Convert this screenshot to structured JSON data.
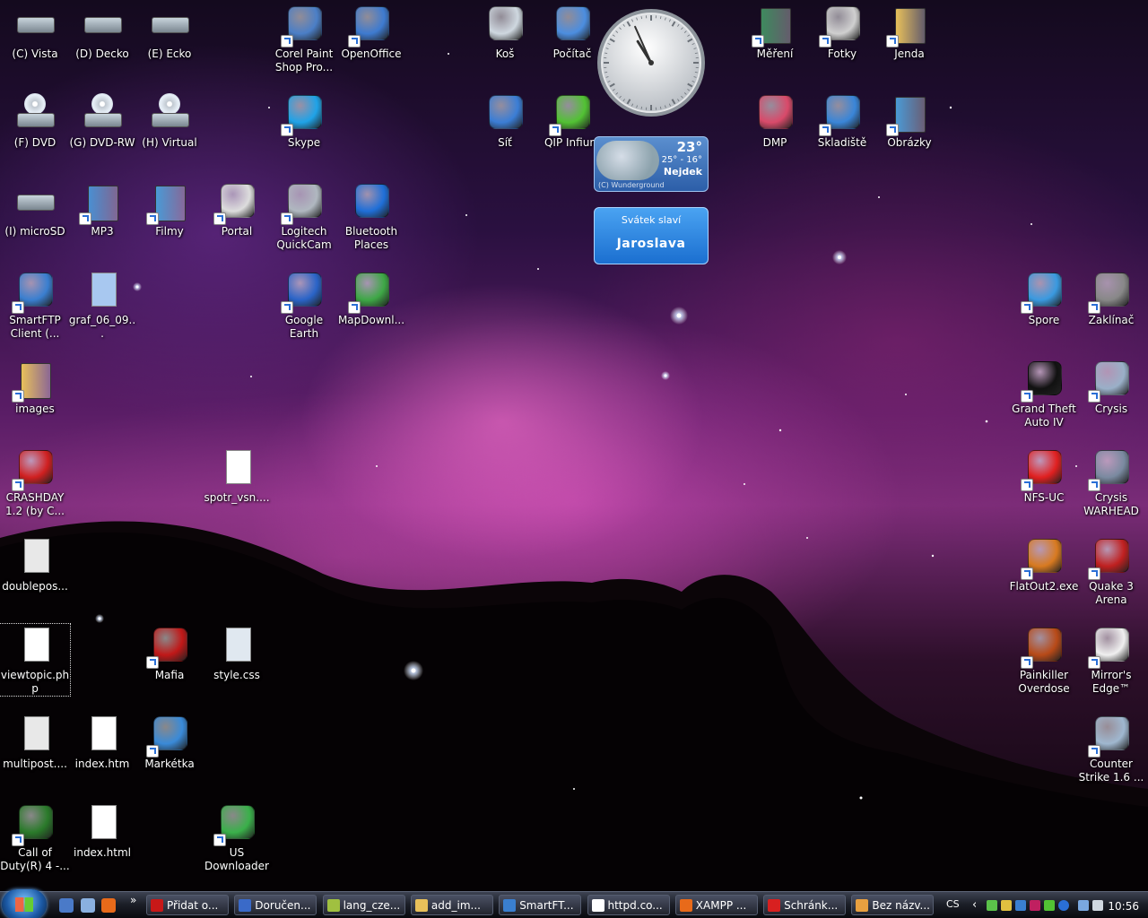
{
  "desktop_icons": [
    {
      "id": "drive-c",
      "label": "(C) Vista",
      "icon": "hard-drive-icon",
      "color": "#c8d4dc"
    },
    {
      "id": "drive-d",
      "label": "(D) Decko",
      "icon": "hard-drive-icon",
      "color": "#c8d4dc"
    },
    {
      "id": "drive-e",
      "label": "(E) Ecko",
      "icon": "hard-drive-icon",
      "color": "#c8d4dc"
    },
    {
      "id": "corel",
      "label": "Corel Paint Shop Pro...",
      "icon": "camera-lens-icon",
      "color": "#4b7fc7"
    },
    {
      "id": "openoffice",
      "label": "OpenOffice",
      "icon": "openoffice-icon",
      "color": "#3e7bd0"
    },
    {
      "id": "kos",
      "label": "Koš",
      "icon": "recycle-bin-icon",
      "color": "#cfd8e0"
    },
    {
      "id": "pocitac",
      "label": "Počítač",
      "icon": "computer-icon",
      "color": "#4c8ee0"
    },
    {
      "id": "mereni",
      "label": "Měření",
      "icon": "folder-icon",
      "color": "#3e8a5e"
    },
    {
      "id": "fotky",
      "label": "Fotky",
      "icon": "camera-icon",
      "color": "#d0d0d0"
    },
    {
      "id": "jenda",
      "label": "Jenda",
      "icon": "folder-icon",
      "color": "#e8c05a"
    },
    {
      "id": "drive-f",
      "label": "(F) DVD",
      "icon": "dvd-drive-icon",
      "color": "#c8d4dc"
    },
    {
      "id": "drive-g",
      "label": "(G) DVD-RW",
      "icon": "dvd-drive-icon",
      "color": "#c8d4dc"
    },
    {
      "id": "drive-h",
      "label": "(H) Virtual",
      "icon": "hd-dvd-drive-icon",
      "color": "#c8d4dc"
    },
    {
      "id": "skype",
      "label": "Skype",
      "icon": "skype-icon",
      "color": "#1fa3e8"
    },
    {
      "id": "sit",
      "label": "Síť",
      "icon": "network-icon",
      "color": "#3b7ed6"
    },
    {
      "id": "qip",
      "label": "QIP Infium",
      "icon": "qip-icon",
      "color": "#52c234"
    },
    {
      "id": "dmp",
      "label": "DMP",
      "icon": "dmp-icon",
      "color": "#d94a6a"
    },
    {
      "id": "skladiste",
      "label": "Skladiště",
      "icon": "monitor-icon",
      "color": "#3a86d8"
    },
    {
      "id": "obrazky",
      "label": "Obrázky",
      "icon": "folder-icon",
      "color": "#4a9ad6"
    },
    {
      "id": "drive-i",
      "label": "(I) microSD",
      "icon": "hard-drive-icon",
      "color": "#c8d4dc"
    },
    {
      "id": "mp3",
      "label": "MP3",
      "icon": "music-folder-icon",
      "color": "#4a8fd2"
    },
    {
      "id": "filmy",
      "label": "Filmy",
      "icon": "video-folder-icon",
      "color": "#4a9ad6"
    },
    {
      "id": "portal",
      "label": "Portal",
      "icon": "portal-icon",
      "color": "#dddddd"
    },
    {
      "id": "quickcam",
      "label": "Logitech QuickCam",
      "icon": "webcam-icon",
      "color": "#b0b8c0"
    },
    {
      "id": "bluetooth",
      "label": "Bluetooth Places",
      "icon": "bluetooth-icon",
      "color": "#1f6fd8"
    },
    {
      "id": "smartftp",
      "label": "SmartFTP Client (...",
      "icon": "globe-icon",
      "color": "#3a7fd0"
    },
    {
      "id": "graf",
      "label": "graf_06_09...",
      "icon": "image-file-icon",
      "color": "#a8c8f0"
    },
    {
      "id": "google-earth",
      "label": "Google Earth",
      "icon": "google-earth-icon",
      "color": "#2a64c8"
    },
    {
      "id": "mapdownl",
      "label": "MapDownl...",
      "icon": "earth-globe-icon",
      "color": "#3ea846"
    },
    {
      "id": "spore",
      "label": "Spore",
      "icon": "spore-icon",
      "color": "#3a9ae0"
    },
    {
      "id": "zaklinac",
      "label": "Zaklínač",
      "icon": "witcher-icon",
      "color": "#888888"
    },
    {
      "id": "images",
      "label": "images",
      "icon": "folder-icon",
      "color": "#e8c05a"
    },
    {
      "id": "gta4",
      "label": "Grand Theft Auto IV",
      "icon": "gta-icon",
      "color": "#111111"
    },
    {
      "id": "crysis",
      "label": "Crysis",
      "icon": "crysis-icon",
      "color": "#9ab0c8"
    },
    {
      "id": "crashday",
      "label": "CRASHDAY 1.2 (by C...",
      "icon": "crashday-icon",
      "color": "#d02020"
    },
    {
      "id": "spotr",
      "label": "spotr_vsn....",
      "icon": "blank-file-icon",
      "color": "#ffffff"
    },
    {
      "id": "nfs",
      "label": "NFS-UC",
      "icon": "nfs-icon",
      "color": "#e02020"
    },
    {
      "id": "crysis-warhead",
      "label": "Crysis WARHEAD",
      "icon": "crysis-warhead-icon",
      "color": "#7a8aa0"
    },
    {
      "id": "doublepos",
      "label": "doublepos...",
      "icon": "image-file-icon",
      "color": "#e8e8e8"
    },
    {
      "id": "flatout",
      "label": "FlatOut2.exe",
      "icon": "flatout-icon",
      "color": "#d87a20"
    },
    {
      "id": "quake3",
      "label": "Quake 3 Arena",
      "icon": "quake-icon",
      "color": "#c02020"
    },
    {
      "id": "viewtopic",
      "label": "viewtopic.php",
      "icon": "php-file-icon",
      "color": "#ffffff"
    },
    {
      "id": "mafia",
      "label": "Mafia",
      "icon": "mafia-icon",
      "color": "#c01818"
    },
    {
      "id": "style-css",
      "label": "style.css",
      "icon": "css-file-icon",
      "color": "#e0e8f0"
    },
    {
      "id": "painkiller",
      "label": "Painkiller Overdose",
      "icon": "painkiller-icon",
      "color": "#b84a18"
    },
    {
      "id": "mirrors-edge",
      "label": "Mirror's Edge™",
      "icon": "mirrors-edge-icon",
      "color": "#f0f0f0"
    },
    {
      "id": "multipost",
      "label": "multipost....",
      "icon": "image-file-icon",
      "color": "#e8e8e8"
    },
    {
      "id": "index-htm",
      "label": "index.htm",
      "icon": "blank-file-icon",
      "color": "#ffffff"
    },
    {
      "id": "marketka",
      "label": "Markétka",
      "icon": "msn-icon",
      "color": "#3a8ad8"
    },
    {
      "id": "counter-strike",
      "label": "Counter Strike 1.6 ...",
      "icon": "counter-strike-icon",
      "color": "#a0b8d0"
    },
    {
      "id": "cod4",
      "label": "Call of Duty(R) 4 -...",
      "icon": "cod4-icon",
      "color": "#2a7a2a"
    },
    {
      "id": "index-html",
      "label": "index.html",
      "icon": "blank-file-icon",
      "color": "#ffffff"
    },
    {
      "id": "us-downloader",
      "label": "US Downloader",
      "icon": "recycle-green-icon",
      "color": "#3ab04a"
    }
  ],
  "gadgets": {
    "clock": {
      "hour": 10,
      "minute": 56
    },
    "weather": {
      "temp": "23°",
      "range": "25° - 16°",
      "city": "Nejdek",
      "source": "(C) Wunderground"
    },
    "namedays": {
      "title": "Svátek slaví",
      "name": "Jaroslava"
    }
  },
  "taskbar": {
    "start_icon": "windows-logo-icon",
    "quick_launch": [
      {
        "icon": "show-desktop-icon",
        "color": "#4a7ac8"
      },
      {
        "icon": "switch-windows-icon",
        "color": "#8ab0e0"
      },
      {
        "icon": "firefox-icon",
        "color": "#e86a1a"
      }
    ],
    "overflow_label": "»",
    "tasks": [
      {
        "label": "Přidat o...",
        "icon": "opera-icon",
        "color": "#c81818"
      },
      {
        "label": "Doručen...",
        "icon": "thunderbird-icon",
        "color": "#3a6ac8"
      },
      {
        "label": "lang_cze...",
        "icon": "notepad-icon",
        "color": "#a0c040"
      },
      {
        "label": "add_im...",
        "icon": "folder-icon",
        "color": "#e8c05a"
      },
      {
        "label": "SmartFT...",
        "icon": "globe-icon",
        "color": "#3a7fd0"
      },
      {
        "label": "httpd.co...",
        "icon": "text-file-icon",
        "color": "#ffffff"
      },
      {
        "label": "XAMPP ...",
        "icon": "xampp-icon",
        "color": "#e86a1a"
      },
      {
        "label": "Schránk...",
        "icon": "clipboard-icon",
        "color": "#d82020"
      },
      {
        "label": "Bez názv...",
        "icon": "paint-icon",
        "color": "#e8a040"
      }
    ],
    "language": "CS",
    "tray_expand": "‹",
    "clock": "10:56"
  }
}
